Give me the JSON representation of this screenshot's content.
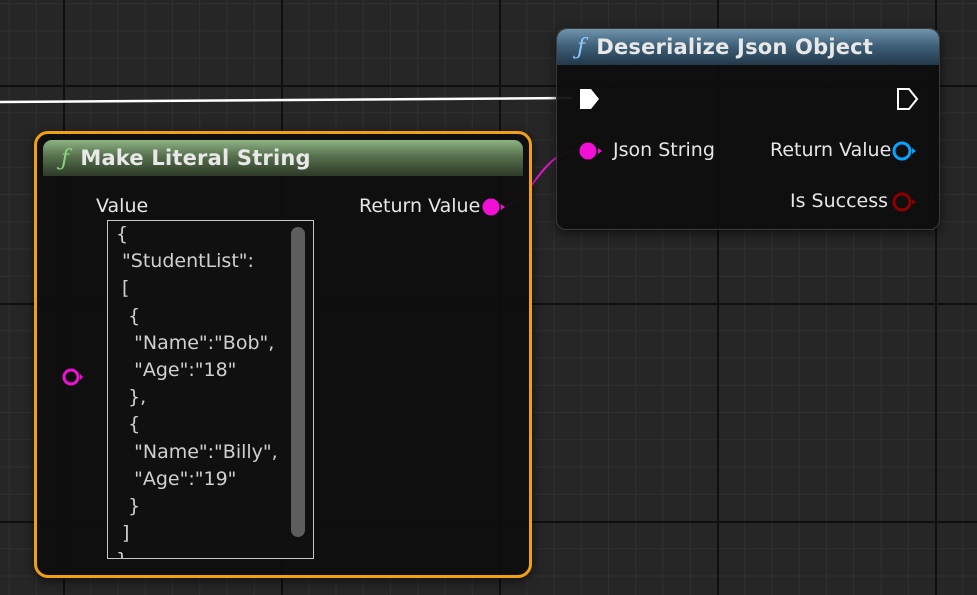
{
  "colors": {
    "string_pin": "#f20fd6",
    "object_pin": "#0aa3ff",
    "bool_pin": "#8c0000",
    "exec_pin": "#ffffff",
    "selection_outline": "#f0a010"
  },
  "icons": {
    "function": "ƒ"
  },
  "make_literal_string": {
    "title": "Make Literal String",
    "value_label": "Value",
    "value_text": "{\n \"StudentList\":\n [\n  {\n   \"Name\":\"Bob\",\n   \"Age\":\"18\"\n  },\n  {\n   \"Name\":\"Billy\",\n   \"Age\":\"19\"\n  }\n ]\n}",
    "return_label": "Return Value"
  },
  "deserialize_json_object": {
    "title": "Deserialize Json Object",
    "json_string_label": "Json String",
    "return_label": "Return Value",
    "is_success_label": "Is Success"
  }
}
